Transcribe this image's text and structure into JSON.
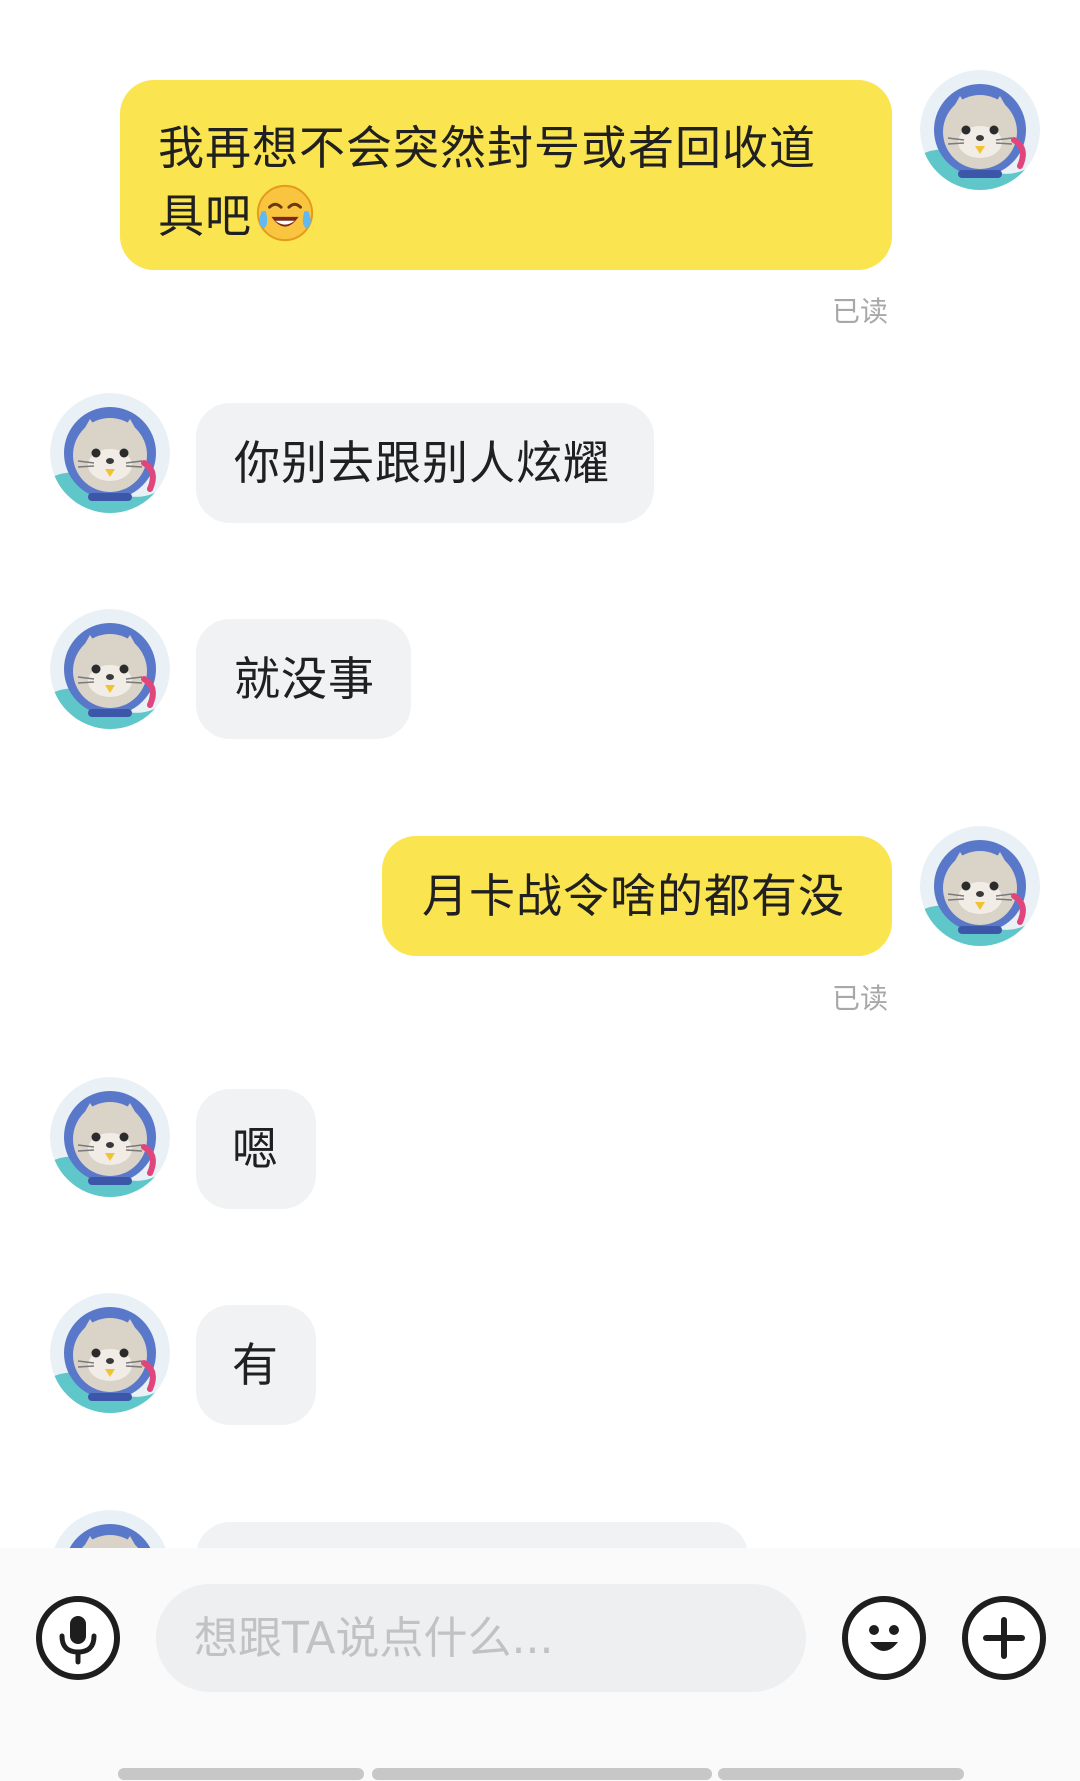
{
  "messages": [
    {
      "from": "me",
      "text": "我再想不会突然封号或者回收道具吧",
      "emoji": "face-with-tears-of-joy",
      "status": "已读"
    },
    {
      "from": "them",
      "text": "你别去跟别人炫耀"
    },
    {
      "from": "them",
      "text": "就没事"
    },
    {
      "from": "me",
      "text": "月卡战令啥的都有没",
      "status": "已读"
    },
    {
      "from": "them",
      "text": "嗯"
    },
    {
      "from": "them",
      "text": "有"
    }
  ],
  "input": {
    "placeholder": "想跟TA说点什么..."
  },
  "icons": {
    "voice": "microphone-icon",
    "emoji": "smiley-icon",
    "more": "plus-icon"
  },
  "colors": {
    "my_bubble": "#fae44f",
    "their_bubble": "#f1f2f4",
    "read_status": "#a8a8a8"
  }
}
